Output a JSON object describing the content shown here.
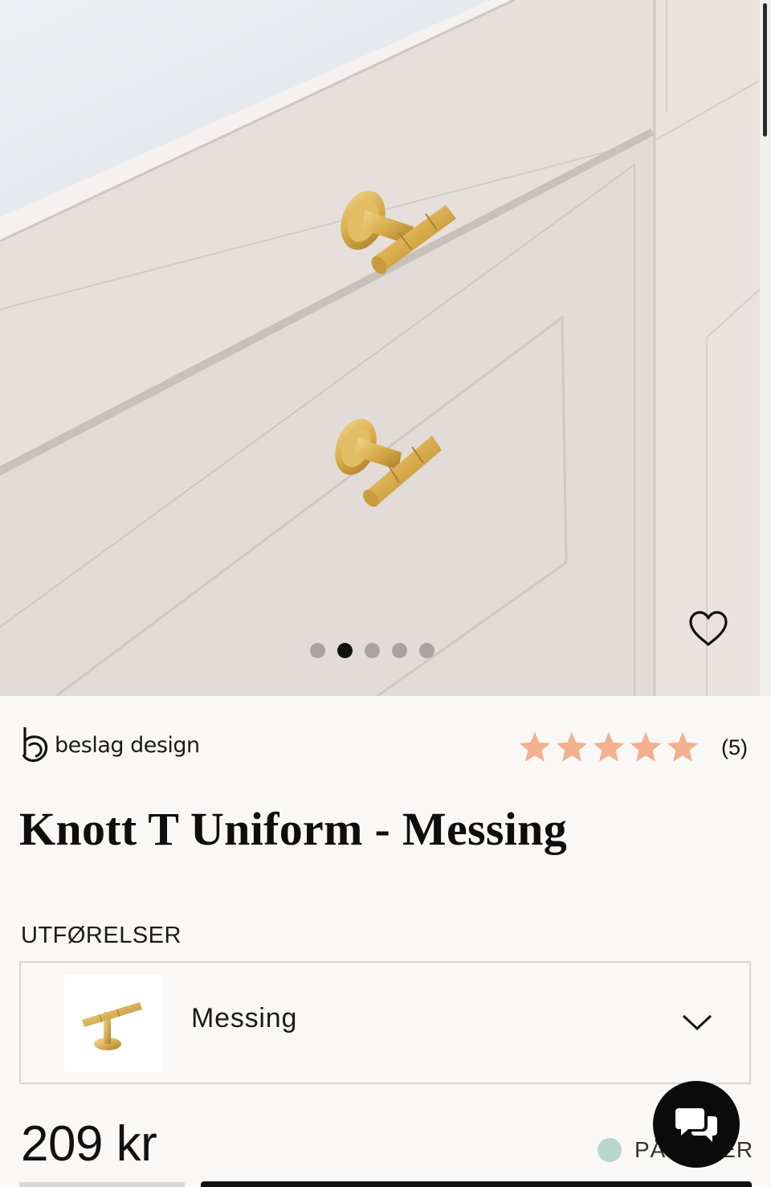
{
  "gallery": {
    "image_alt": "Knott T Uniform - Messing på kjøkkenskuff",
    "slide_count": 5,
    "active_slide": 2
  },
  "brand": {
    "name": "beslag design",
    "logo_icon": "b-logo-icon"
  },
  "rating": {
    "stars": 5,
    "max": 5,
    "count_label": "(5)",
    "star_color": "#f2b08f"
  },
  "product": {
    "title": "Knott T Uniform - Messing"
  },
  "variants": {
    "label": "UTFØRELSER",
    "selected": "Messing"
  },
  "price": {
    "label": "209 kr"
  },
  "stock": {
    "text": "PÅ LAGER",
    "dot_color": "#b9d6cc"
  },
  "icons": {
    "favorite": "heart-outline-icon",
    "chat": "chat-bubbles-icon",
    "dropdown": "chevron-down-icon"
  }
}
